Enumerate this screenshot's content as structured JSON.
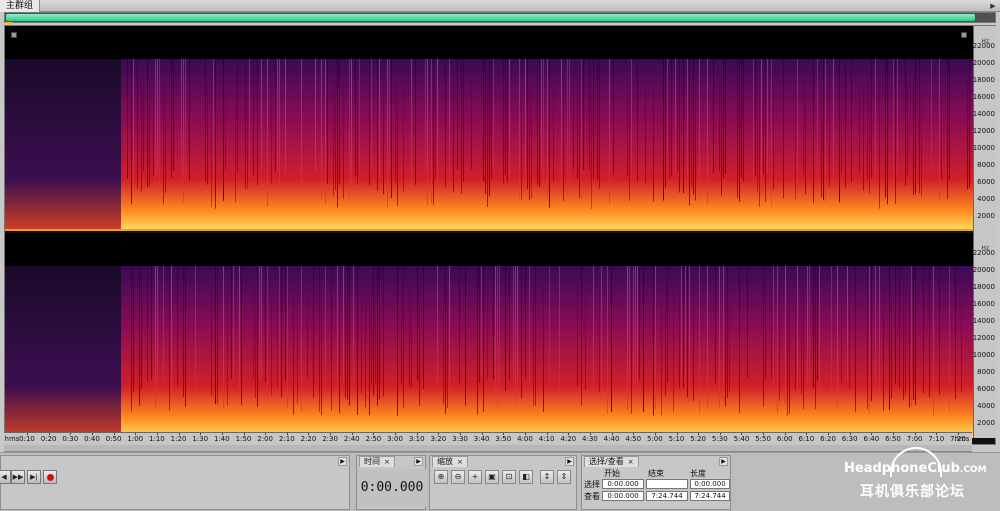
{
  "window": {
    "tab_label": "主群组"
  },
  "spectral_ruler": {
    "unit": "Hz",
    "ticks": [
      "22000",
      "20000",
      "18000",
      "16000",
      "14000",
      "12000",
      "10000",
      "8000",
      "6000",
      "4000",
      "2000"
    ]
  },
  "time_ruler": {
    "format": "hms",
    "ticks": [
      "0:10",
      "0:20",
      "0:30",
      "0:40",
      "0:50",
      "1:00",
      "1:10",
      "1:20",
      "1:30",
      "1:40",
      "1:50",
      "2:00",
      "2:10",
      "2:20",
      "2:30",
      "2:40",
      "2:50",
      "3:00",
      "3:10",
      "3:20",
      "3:30",
      "3:40",
      "3:50",
      "4:00",
      "4:10",
      "4:20",
      "4:30",
      "4:40",
      "4:50",
      "5:00",
      "5:10",
      "5:20",
      "5:30",
      "5:40",
      "5:50",
      "6:00",
      "6:10",
      "6:20",
      "6:30",
      "6:40",
      "6:50",
      "7:00",
      "7:10",
      "7:20"
    ]
  },
  "transport": {
    "buttons": [
      "rewind-end-icon",
      "forward-end-icon",
      "record-icon"
    ]
  },
  "time_panel": {
    "tab": "时间",
    "close": "×",
    "value": "0:00.000"
  },
  "zoom_panel": {
    "tab": "缩放",
    "close": "×"
  },
  "selection_panel": {
    "tab": "选择/查看",
    "close": "×",
    "col_start": "开始",
    "col_end": "结束",
    "col_length": "长度",
    "row_select": "选择",
    "row_view": "查看",
    "select_start": "0:00.000",
    "select_end": "",
    "select_length": "0:00.000",
    "view_start": "0:00.000",
    "view_end": "7:24.744",
    "view_length": "7:24.744"
  },
  "watermark": {
    "name": "HeadphoneClub",
    "domain": ".COM",
    "chinese": "耳机俱乐部论坛"
  },
  "colors": {
    "overview": "#48d8a0",
    "spectrum_low": "#2a0a3a",
    "spectrum_mid": "#c0103c",
    "spectrum_high": "#ffd040",
    "record": "#d01010"
  }
}
